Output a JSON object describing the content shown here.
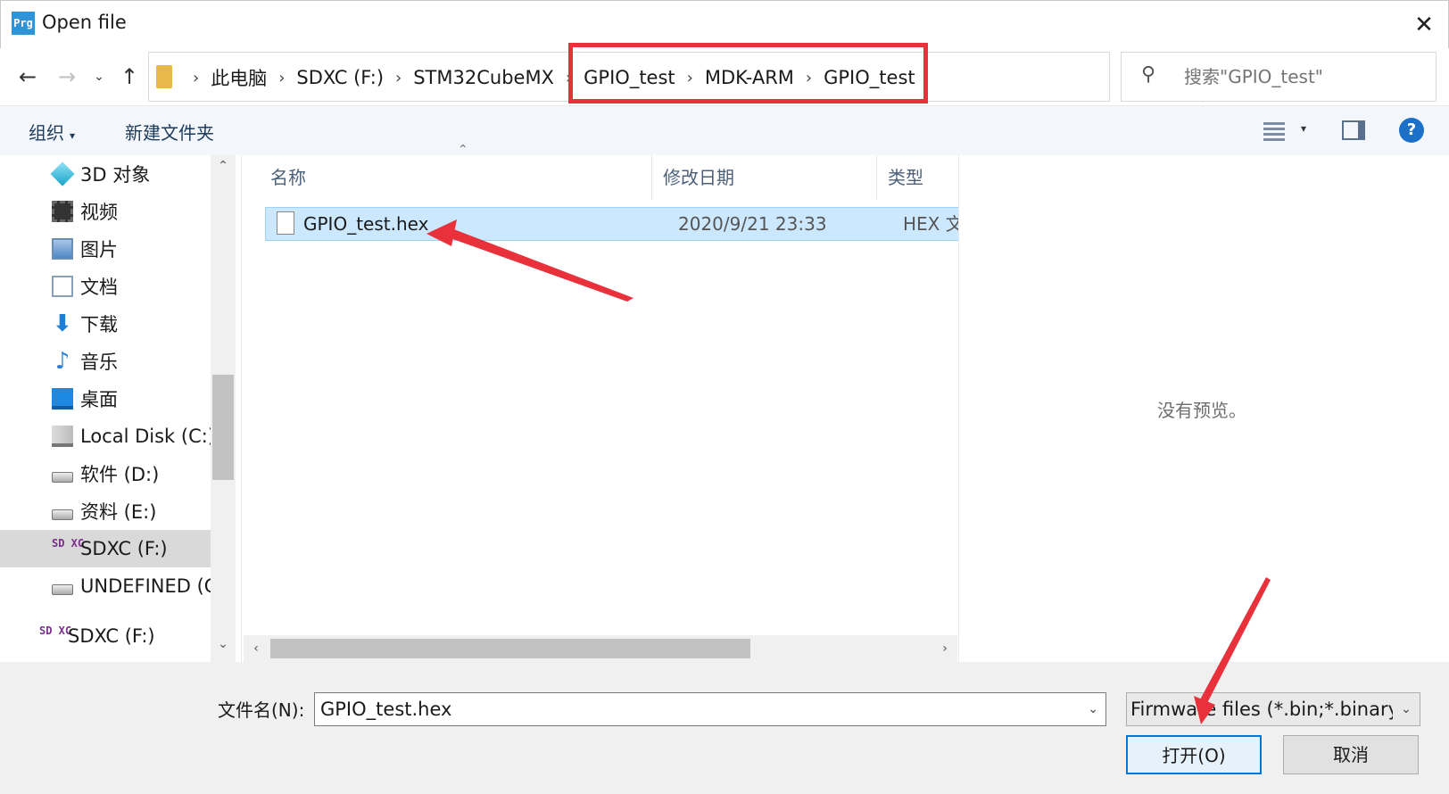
{
  "window": {
    "app_icon_text": "Prg",
    "title": "Open file",
    "close_glyph": "✕"
  },
  "nav": {
    "back_glyph": "←",
    "forward_glyph": "→",
    "recent_glyph": "⌄",
    "up_glyph": "↑",
    "breadcrumbs": [
      "此电脑",
      "SDXC (F:)",
      "STM32CubeMX",
      "GPIO_test",
      "MDK-ARM",
      "GPIO_test"
    ],
    "separator": "›",
    "dropdown_glyph": "⌄",
    "refresh_glyph": "↻",
    "search_placeholder": "搜索\"GPIO_test\""
  },
  "toolbar": {
    "organize_label": "组织",
    "new_folder_label": "新建文件夹",
    "help_glyph": "?"
  },
  "sidebar": {
    "items": [
      {
        "label": "3D 对象",
        "icon": "cube-icon"
      },
      {
        "label": "视频",
        "icon": "video-icon"
      },
      {
        "label": "图片",
        "icon": "picture-icon"
      },
      {
        "label": "文档",
        "icon": "document-icon"
      },
      {
        "label": "下载",
        "icon": "download-icon"
      },
      {
        "label": "音乐",
        "icon": "music-icon"
      },
      {
        "label": "桌面",
        "icon": "desktop-icon"
      },
      {
        "label": "Local Disk (C:)",
        "icon": "windows-drive-icon"
      },
      {
        "label": "软件 (D:)",
        "icon": "drive-icon"
      },
      {
        "label": "资料 (E:)",
        "icon": "drive-icon"
      },
      {
        "label": "SDXC (F:)",
        "icon": "sdxc-icon",
        "selected": true
      },
      {
        "label": "UNDEFINED (G:)",
        "icon": "drive-icon"
      },
      {
        "label": "SDXC (F:)",
        "icon": "sdxc-icon"
      }
    ],
    "sd_icon_text": "SD XC"
  },
  "files": {
    "columns": [
      "名称",
      "修改日期",
      "类型"
    ],
    "rows": [
      {
        "name": "GPIO_test.hex",
        "modified": "2020/9/21 23:33",
        "type": "HEX 文件",
        "selected": true
      }
    ]
  },
  "preview": {
    "text": "没有预览。"
  },
  "bottom": {
    "filename_label": "文件名(N):",
    "filename_value": "GPIO_test.hex",
    "filter_value": "Firmware files (*.bin;*.binary;*.hex)",
    "open_label": "打开(O)",
    "cancel_label": "取消"
  },
  "colors": {
    "annotation_red": "#e8313a",
    "selection_blue": "#cce8ff",
    "accent": "#0078d7"
  }
}
